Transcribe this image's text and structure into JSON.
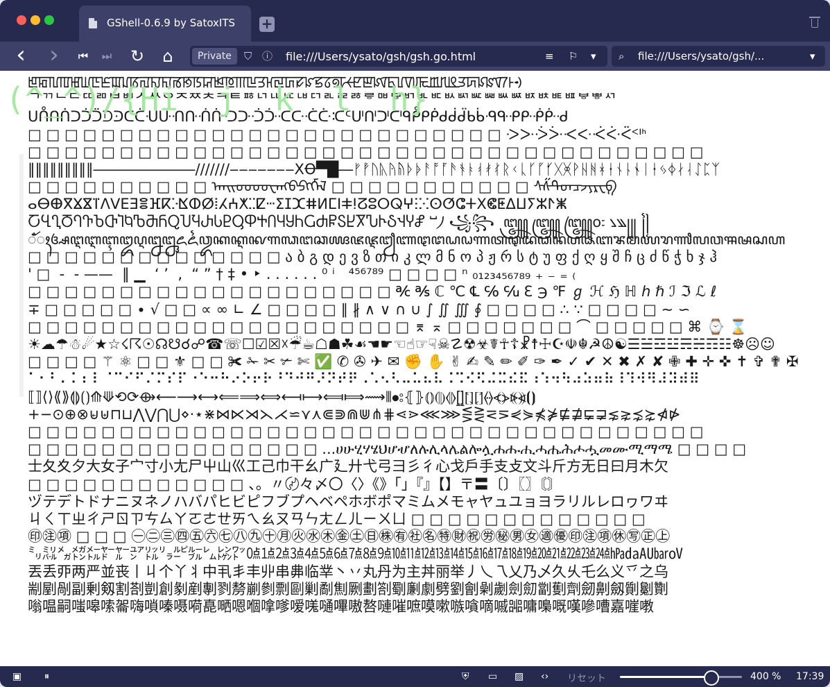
{
  "titlebar": {
    "tab_title": "GShell-0.6.9 by SatoxITS",
    "new_tab_label": "+"
  },
  "toolbar": {
    "back": "‹",
    "forward": "›",
    "first": "⏮",
    "step": "⏭",
    "reload": "↻",
    "home": "⌂",
    "private_label": "Private",
    "shield": "⛉",
    "info": "ⓘ",
    "url": "file:///Users/ysato/gsh/gsh.go.html",
    "reader": "≡",
    "bookmark": "⚐",
    "dropdown": "▾",
    "search_icon": "⌕",
    "search_text": "file:///Users/ysato/gsh/..."
  },
  "content": {
    "prompt": "(^_^)/{Hi  j  k  l  h}",
    "lines": [
      "ꡁꡂꡃꡄꡅꡆꡇꡈꡉꡊꡋꡌꡍꡎꡏꡐꡑꡒꡓꡔꡕꡖꡗꡘꡙꡚꡛꡜꡝꡞꡟꡠꡡꡢꡣꡤꡥꡦꡧꡨꡩꡪꡫꡬꡭꡮꡯꡰꡱꡲꡳ",
      "ᄀᄁᄂᄃᄄᄅᄆᄇᄈᄉᄊᄋᄌᄍᄎᄏᄐᄑᄒᄓᄔᄕᄖᄗᄘᄙᄚᄛᄜᄝᄞᄟᄠᄡᄢᄣᄤᄥᄦᄧᄨᄩᄪᄫᄬᄭ",
      "ᑌᑍᑎᑏᑐᑑᑒᑓᑔᑕᑖᑗᑘᑙᑚᑛᑜᑝᑞᑟᑠᑡᑢᑣᑤᑥᑦᑧᑨᑩᑪᑫᑬᑭᑮᑯᑰᑱᑲᑳᑴᑵᑶᑷᑸᑹᑺ",
      "□ □ □ □ □ □ □ □ □ □ □ □ □ □ □ □ □ □ □ □ □ □ □ □ □ □ ᑀᑁᑂᑃᑄᑅᑆᑇᑈᑉᑊᑋ",
      "□ □ □ □ □ □ □ □ □ □ □ □ □ □ □ □ □ □ □ □ □ □ □ □ □ □ □ □ □ □ □ □ □ □ □ □ □",
      "‖‖‖‖‖‖‖‖‖―――――――///////‒‒‒‒‒‒‒XꝊ▀█―ᚠᚡᚢᚣᚤᚥᚦᚧᚨᚩᚪᚫᚬᚭᚮᚯᚰᚱᚲᚳᚴᚵᚶᚷᚸᚹᚺᚻᚼᚽᚾᚿᛀᛁᛂᛃᛄᛅᛆᛇᛈᛉ",
      "□ □ □ □ □ □ □ □ □ □ ᠠᠡᠢᠣᠤᠥᠦᠧᠨᠩᠪᠫᠬᠭᠮᠯ □ □ □ □ □ □ □ □ □ □ □ ᠰᠱᠲᠳᠴᠵᠶᠷᠸᠹ",
      "ⴰⴱⴲⴳⴴⴵⴶⴷⴸⴹⴺⴻⴼⴽⴾⴿⵀⵁⵂⵃⵄⵅⵆⵇⵈⵉⵊⵋⵌⵍⵎⵏⵐⵑⵒⵓⵔⵕⵖⵗⵘⵙⵚⵛⵜⵝⵞⵟⵠⵡⵢⵣⵤⵥ",
      "ႠႡႢႣႤႥႦႧႨႩႪႫႬႭႮႯႰႱႲႳႴႵႶႷႸႹႺႻႼႽႾႿჀჁჂჃჄჅ ⵯ⵰ ꧁꧂ ꧃꧄꧅꧆꧇ ꧈꧉꧊꧋ ꧌꧍",
      "ꦀꦁꦂꦃꦄꦅꦆꦇꦈꦉꦊꦋꦌꦍꦎꦏꦐꦑꦒꦓꦔꦕꦖꦗꦘꦙꦚꦛꦜꦝꦞꦟꦠꦡꦢꦣꦤꦥꦦꦧꦨꦩꦪꦫꦬꦭꦮꦯꦰꦱꦲ",
      "□ □ □ □ □ □ □ □ □ □ □ □ □ □ ა ბ გ დ ე ვ ზ თ ი კ ლ მ ნ ო პ ჟ რ ს ტ უ ფ ქ ღ ყ შ ჩ ც ძ წ ჭ ხ ჯ ჰ",
      "' □  -  - ——  ‖ ▁  ‘ ’  ‚  “ ” † ‡ • ‣ . . . . . . ⁰ ⁱ   ⁴⁵⁶⁷⁸⁹ □ □ □ □ ⁿ ₀₁₂₃₄₅₆₇₈₉ ₊ ₋ ₌ ₍",
      "□ □ □ □ □ □ □ □ □ □ □ □ □ □ □ □ □ □ □ □ ℀ ℁ ℂ ℃ ℄ ℅ ℆ ℇ ℈ ℉ ℊ ℋ ℌ ℍ ℎ ℏ ℐ ℑ ℒ ℓ",
      "∓ □ □ □ □ □ ∙ √ □ □ ∝ ∞ ∟ ∠ □ □ □ □ ∥ ∦ ∧ ∨ ∩ ∪ ∫ ∬ ∭ ∮ □ □ □ □ ∴ ∵ □ □ □ □ ∼ ∽",
      "□ □ □ □ □ □ □ □ □ □ □ □ □ □ □ □ □ □ □ □ □ ⌆ ⌅ □ □ □ □ □ □ □ ⌒ □ □ □ □ □ ⌘ ⌚ ⌛",
      "☀☁☂☃☄★☆☇☈☉☊☋☌☍☎☏☐☑☒☓☔☕☖☗☘☙☚☛☜☝☞☟☠☡☢☣☤☥☦☧☨☩☪☫☬☭☮☯☰☱☲☳☴☵☶☷☸☹☺",
      "□ □ □ □ ⚚ ⚛ □ □ ⚜ □ □ ✀ ✁ ✂ ✃ ✄ ✅ ✆ ✇ ✈ ✉ ✊ ✋ ✌ ✍ ✎ ✏ ✐ ✑ ✒ ✓ ✔ ✕ ✖ ✗ ✘ ✙ ✚ ✛ ✜ ✝ ✞ ✟ ✠",
      "⠁⠂⠃⠄⠅⠆⠇⠈⠉⠊⠋⠌⠍⠎⠏⠐⠑⠒⠓⠔⠕⠖⠗⠘⠙⠚⠛⠜⠝⠞⠟⠠⠡⠢⠣⠤⠥⠦⠧⠨⠩⠪⠫⠬⠭⠮⠯⠰⠱⠲⠳⠴⠵⠶⠷⠸⠹⠺⠻⠼⠽⠾⠿",
      "⟦⟧⟨⟩⟪⟫⟬⟭⟮⟯⟰⟱⟲⟳⟴⟵⟶⟷⟸⟹⟺⟻⟼⟽⟾⟿⦀⦁⦂⦃⦄⦅⦆⦇⦈⦉⦊⦋⦌⦍⦎⦏⦐⦑⦒⦓⦔⦕⦖⦗⦘",
      "+−⊙⊕⊗⊌⊎⊓⊔⋀⋁⋂⋃⋄⋅⋆⋇⋈⋉⋊⋋⋌⋍⋎⋏⋐⋑⋒⋓⋔⋕⋖⋗⋘⋙⋚⋛⋜⋝⋞⋟⋠⋡⋢⋣⋤⋥⋦⋧⋨⋩⋪⋫",
      "□ □ □ □ □ □ □ □ □ □ □ □ □ □ □ □ □ □ □ □ □ □ □ □ □ □ □ □ □ □ □ □ □ □ □ □ □",
      "□ □ □ □ □ □ □ □ □ □ □ □ □ □ □ □ ...ሀሁሂሃሄህሆሇለሉሊላሌልሎሏሐሑሒሓሔሕሖሗመሙሚማሜ □ □ □ □",
      "士夂夊夕大女子宀寸小尢尸屮山巛工己巾干幺广廴廾弋弓彐彡彳心戈戶手支攴文斗斤方无日曰月木欠",
      "□ □ □ □ □ □ □ □ □ □ □ □ 、。〃〄々〆〇〈〉《》「」『』【】〒〓〔〕〖〗〘〙",
      "ヅテデトドナニヌネノハバパヒビピフブプヘベペホボポマミムメモャヤュユョヨラリルレロヮワヰ",
      "ㄐㄑㄒㄓㄔㄕㄖㄗㄘㄙㄚㄛㄜㄝㄞㄟㄠㄡㄢㄣㄤㄥㄦㄧㄨㄩ □ □ □ □ □ □ □ □ □ □ □ □ □",
      "㊞㊟㊠ □ □ □ ㊀㊁㊂㊃㊄㊅㊆㊇㊈㊉㊊㊋㊌㊍㊎㊏㊐㊑㊒㊓㊔㊕㊖㊗㊘㊙㊚㊛㊜㊝㊞㊟㊠㊡㊢㊣㊤",
      "㍉㍊㍋㍌㍍㍎㍏㍐㍑㍒㍓㍔㍕㍖㍗㍘㍙㍚㍛㍜㍝㍞㍟㍠㍡㍢㍣㍤㍥㍦㍧㍨㍩㍪㍫㍬㍭㍮㍯㍰㍱㍲㍳㍴㍵",
      "丟丢丣两严並丧丨丩个丫丬中丮丯丰丱串丳临丵丶丷丸丹为主丼丽举丿乀乁乂乃乄久乆乇么义乊之乌",
      "剬剭剮副剰剱割剳剴創剶剷剸剹剺剻剼剽剾剿劀劁劂劃劄劅劆劇劈劉劊劋劌劍劎劏劐劑劒劓劔劕劖劗",
      "嗡嗢嗣嗤嗥嗦嗧嗨嗩嗪嗫嗬嗭嗮嗯嗰嗱嗲嗳嗴嗵嗶嗷嗸嗹嗺嗻嗼嗽嗾嗿嘀嘁嘂嘃嘄嘅嘆嘇嘈嘉嘊嘋"
    ]
  },
  "statusbar": {
    "sidebar_icon": "▣",
    "pause_icon": "⏸",
    "shield_icon": "⛨",
    "window_icon": "▭",
    "image_icon": "▨",
    "code_icon": "‹›",
    "reset_label": "リセット",
    "zoom_fraction": 0.75,
    "zoom_label": "400 %",
    "time": "17:39"
  }
}
